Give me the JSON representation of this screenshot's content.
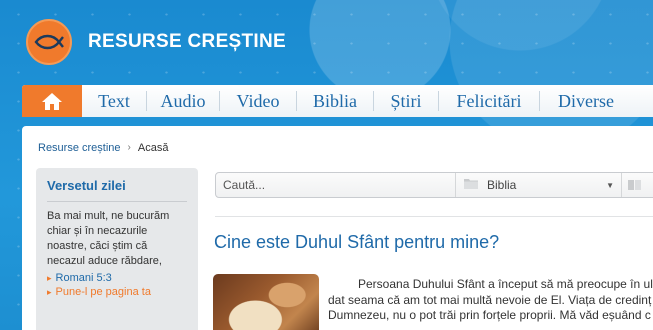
{
  "site": {
    "title": "RESURSE CREȘTINE",
    "logo_icon": "fish-icon",
    "accent": "#f07a2c",
    "brand": "#1f6aa9"
  },
  "nav": {
    "home_icon": "home-icon",
    "items": [
      {
        "label": "Text"
      },
      {
        "label": "Audio"
      },
      {
        "label": "Video"
      },
      {
        "label": "Biblia"
      },
      {
        "label": "Știri"
      },
      {
        "label": "Felicitări"
      },
      {
        "label": "Diverse"
      }
    ]
  },
  "breadcrumb": {
    "root": "Resurse creștine",
    "current": "Acasă"
  },
  "sidebar": {
    "title": "Versetul zilei",
    "verse": "Ba mai mult, ne bucurăm chiar și în necazurile noastre, căci știm că necazul aduce răbdare,",
    "reference": "Romani 5:3",
    "share": "Pune-l pe pagina ta"
  },
  "search": {
    "placeholder": "Caută...",
    "selected": "Biblia"
  },
  "article": {
    "title": "Cine este Duhul Sfânt pentru mine?",
    "lines": [
      "Persoana Duhului Sfânt a început să mă preocupe în ultim",
      "dat seama că am tot mai multă nevoie de El. Viața de credinț",
      "Dumnezeu, nu o pot trăi prin forțele proprii. Mă văd eșuând c"
    ]
  }
}
